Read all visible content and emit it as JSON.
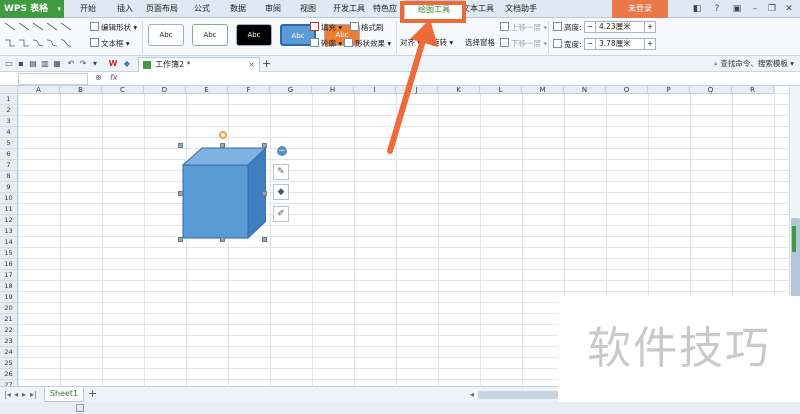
{
  "app": {
    "title": "WPS 表格"
  },
  "menus": [
    "开始",
    "插入",
    "页面布局",
    "公式",
    "数据",
    "审阅",
    "视图",
    "开发工具",
    "特色应",
    "绘图工具",
    "文本工具",
    "文档助手"
  ],
  "active_menu": "绘图工具",
  "login_label": "未登录",
  "ribbon": {
    "edit_shape": "编辑形状",
    "text_box": "文本框",
    "style_samples": [
      "Abc",
      "Abc",
      "Abc",
      "Abc",
      "Abc"
    ],
    "fill": "填充",
    "format_brush": "格式刷",
    "outline": "轮廓",
    "shape_effects": "形状效果",
    "align": "对齐",
    "rotate": "旋转",
    "selection_pane": "选择窗格",
    "bring_forward": "上移一层",
    "send_backward": "下移一层",
    "height_label": "高度:",
    "height_value": "4.23厘米",
    "width_label": "宽度:",
    "width_value": "3.78厘米"
  },
  "document_tab": "工作簿2 *",
  "search_hint": "查找命令、搜索模板",
  "formula_bar": {
    "fx": "fx"
  },
  "columns": [
    "A",
    "B",
    "C",
    "D",
    "E",
    "F",
    "G",
    "H",
    "I",
    "J",
    "K",
    "L",
    "M",
    "N",
    "O",
    "P",
    "Q",
    "R"
  ],
  "rows": [
    "1",
    "2",
    "3",
    "4",
    "5",
    "6",
    "7",
    "8",
    "9",
    "10",
    "11",
    "12",
    "13",
    "14",
    "15",
    "16",
    "17",
    "18",
    "19",
    "20",
    "21",
    "22",
    "23",
    "24",
    "25",
    "26",
    "27"
  ],
  "sheet_tab": "Sheet1",
  "watermark": "软件技巧",
  "colors": {
    "accent": "#3f9b3f",
    "highlight": "#ee6b39",
    "cube_front": "#5b9bd5",
    "cube_top": "#7fb2e3",
    "cube_side": "#3f7fbf"
  }
}
